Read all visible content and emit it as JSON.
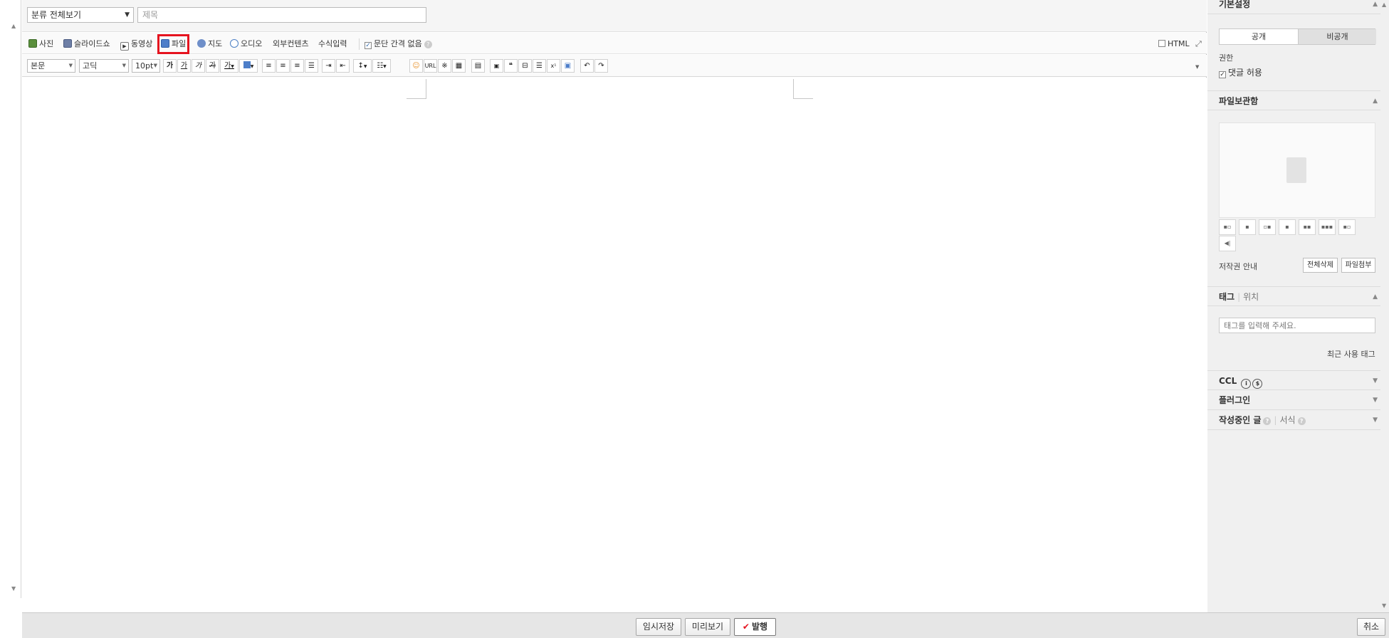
{
  "header": {
    "category": "분류 전체보기",
    "title_placeholder": "제목"
  },
  "insert_toolbar": {
    "items": [
      "사진",
      "슬라이드쇼",
      "동영상",
      "파일",
      "지도",
      "오디오",
      "외부컨텐츠",
      "수식입력"
    ],
    "paragraph_option": "문단 간격 없음",
    "html_label": "HTML"
  },
  "format_toolbar": {
    "paragraph": "본문",
    "font": "고딕",
    "size": "10pt",
    "text_buttons": [
      "가",
      "가",
      "가",
      "가",
      "가"
    ],
    "url_label": "URL"
  },
  "sidebar": {
    "basic": {
      "title": "기본설정",
      "public": "공개",
      "private": "비공개",
      "permission_label": "권한",
      "comment_allow": "댓글 허용"
    },
    "file_box": {
      "title": "파일보관함",
      "copyright": "저작권 안내",
      "delete_all": "전체삭제",
      "attach": "파일첨부"
    },
    "tag": {
      "title": "태그",
      "location": "위치",
      "placeholder": "태그를 입력해 주세요.",
      "recent": "최근 사용 태그"
    },
    "ccl": "CCL",
    "plugin": "플러그인",
    "drafts": "작성중인 글",
    "format": "서식"
  },
  "bottom": {
    "temp_save": "임시저장",
    "preview": "미리보기",
    "publish": "발행",
    "cancel": "취소"
  },
  "colors": {
    "highlight": "#e5131f",
    "sidebar_bg": "#f0f0f0",
    "bottom_bg": "#e6e6e6"
  }
}
